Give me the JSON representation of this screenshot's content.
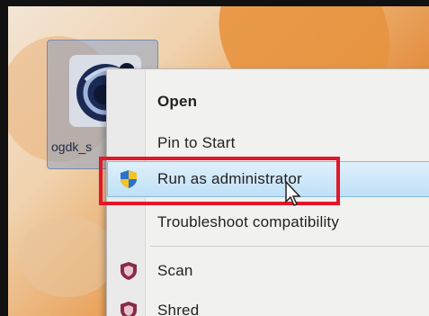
{
  "desktop_icon": {
    "label": "ogdk_s"
  },
  "context_menu": {
    "items": [
      {
        "label": "Open",
        "bold": true,
        "icon": ""
      },
      {
        "label": "Pin to Start",
        "bold": false,
        "icon": ""
      },
      {
        "label": "Run as administrator",
        "bold": false,
        "icon": "uac-shield-icon",
        "highlighted": true
      },
      {
        "label": "Troubleshoot compatibility",
        "bold": false,
        "icon": ""
      },
      {
        "label": "Scan",
        "bold": false,
        "icon": "antivirus-shield-icon"
      },
      {
        "label": "Shred",
        "bold": false,
        "icon": "antivirus-shield-icon"
      }
    ]
  },
  "colors": {
    "highlight_box": "#e3162a",
    "menu_background": "#f1f1ef",
    "hover_row": "#bfe0f6"
  }
}
